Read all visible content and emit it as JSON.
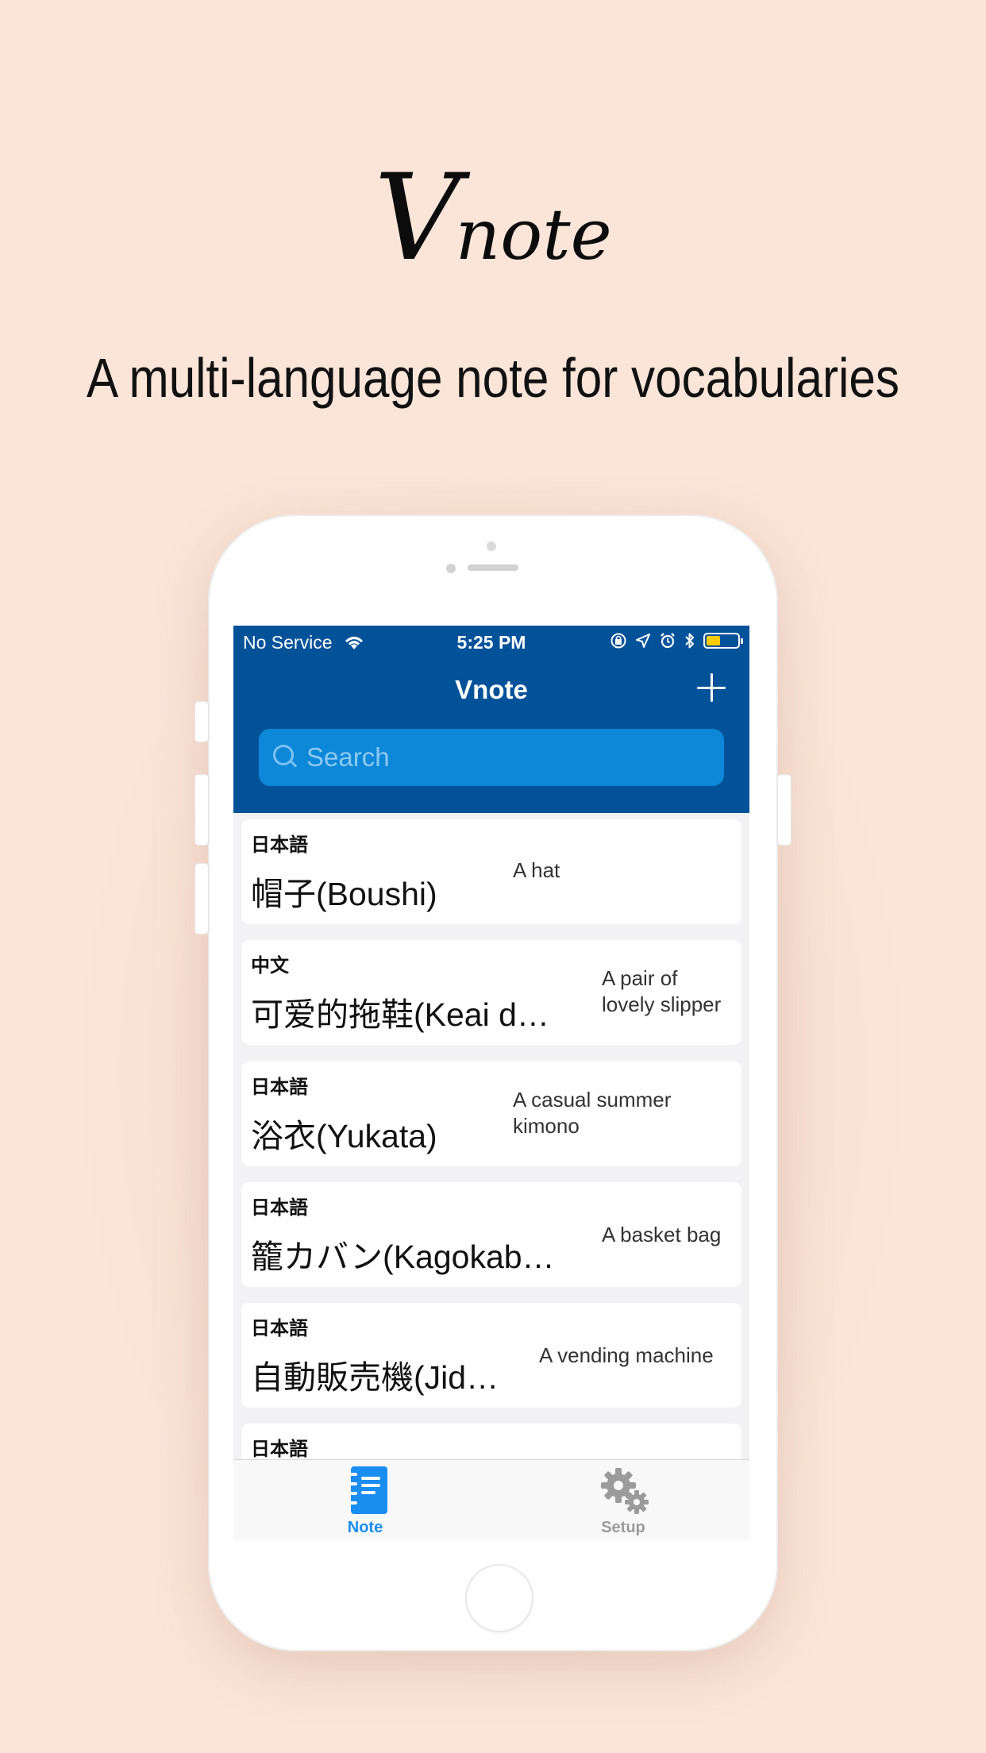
{
  "promo": {
    "logo_v": "V",
    "logo_rest": "note",
    "tagline": "A multi-language note for vocabularies"
  },
  "status_bar": {
    "carrier": "No Service",
    "time": "5:25 PM",
    "battery_level": 0.45,
    "icons": [
      "wifi-icon",
      "orientation-lock-icon",
      "location-arrow-icon",
      "alarm-icon",
      "bluetooth-icon",
      "battery-icon"
    ]
  },
  "nav": {
    "title": "Vnote",
    "add_icon": "plus-icon"
  },
  "search": {
    "placeholder": "Search"
  },
  "notes": [
    {
      "language": "日本語",
      "word": "帽子(Boushi)",
      "meaning": "A hat"
    },
    {
      "language": "中文",
      "word": "可爱的拖鞋(Keai d…",
      "meaning": "A pair of\nlovely slipper"
    },
    {
      "language": "日本語",
      "word": "浴衣(Yukata)",
      "meaning": "A casual summer\nkimono"
    },
    {
      "language": "日本語",
      "word": "籠カバン(Kagokab…",
      "meaning": "A basket bag"
    },
    {
      "language": "日本語",
      "word": "自動販売機(Jid…",
      "meaning": "A vending machine"
    },
    {
      "language": "日本語",
      "word": "",
      "meaning": ""
    }
  ],
  "tabs": [
    {
      "label": "Note",
      "icon": "notebook-icon",
      "active": true,
      "color": "#1a8df0"
    },
    {
      "label": "Setup",
      "icon": "gears-icon",
      "active": false,
      "color": "#9b9b9b"
    }
  ],
  "colors": {
    "background": "#fbe5d8",
    "header": "#02529a",
    "search_field": "#0d88d8",
    "accent": "#1a8df0"
  }
}
